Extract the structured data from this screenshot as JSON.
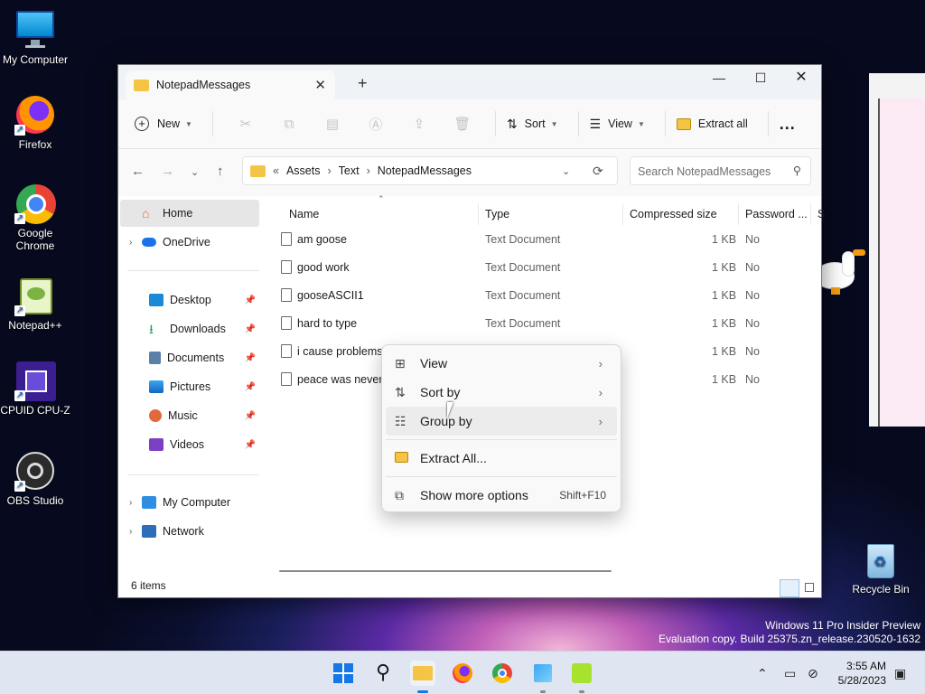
{
  "desktop": {
    "icons": [
      {
        "label": "My Computer"
      },
      {
        "label": "Firefox"
      },
      {
        "label": "Google Chrome"
      },
      {
        "label": "Notepad++"
      },
      {
        "label": "CPUID CPU-Z"
      },
      {
        "label": "OBS Studio"
      }
    ],
    "recycle_bin": "Recycle Bin",
    "watermark_line1": "Windows 11 Pro Insider Preview",
    "watermark_line2": "Evaluation copy. Build 25375.zn_release.230520-1632"
  },
  "window": {
    "tab_title": "NotepadMessages",
    "toolbar": {
      "new_label": "New",
      "sort_label": "Sort",
      "view_label": "View",
      "extract_label": "Extract all",
      "more_label": "..."
    },
    "breadcrumb": {
      "overflow": "«",
      "items": [
        "Assets",
        "Text",
        "NotepadMessages"
      ]
    },
    "search_placeholder": "Search NotepadMessages",
    "sidebar": {
      "home": "Home",
      "onedrive": "OneDrive",
      "desktop": "Desktop",
      "downloads": "Downloads",
      "documents": "Documents",
      "pictures": "Pictures",
      "music": "Music",
      "videos": "Videos",
      "mycomputer": "My Computer",
      "network": "Network"
    },
    "columns": {
      "name": "Name",
      "type": "Type",
      "compressed": "Compressed size",
      "password": "Password ...",
      "extra": "S"
    },
    "files": [
      {
        "name": "am goose",
        "type": "Text Document",
        "size": "1 KB",
        "password": "No"
      },
      {
        "name": "good work",
        "type": "Text Document",
        "size": "1 KB",
        "password": "No"
      },
      {
        "name": "gooseASCII1",
        "type": "Text Document",
        "size": "1 KB",
        "password": "No"
      },
      {
        "name": "hard to type",
        "type": "Text Document",
        "size": "1 KB",
        "password": "No"
      },
      {
        "name": "i cause problems",
        "type": "",
        "size": "1 KB",
        "password": "No"
      },
      {
        "name": "peace was never",
        "type": "",
        "size": "1 KB",
        "password": "No"
      }
    ],
    "status": "6 items"
  },
  "context_menu": {
    "view": "View",
    "sort_by": "Sort by",
    "group_by": "Group by",
    "extract_all": "Extract All...",
    "show_more": "Show more options",
    "show_more_shortcut": "Shift+F10"
  },
  "clock": {
    "time": "3:55 AM",
    "date": "5/28/2023"
  }
}
